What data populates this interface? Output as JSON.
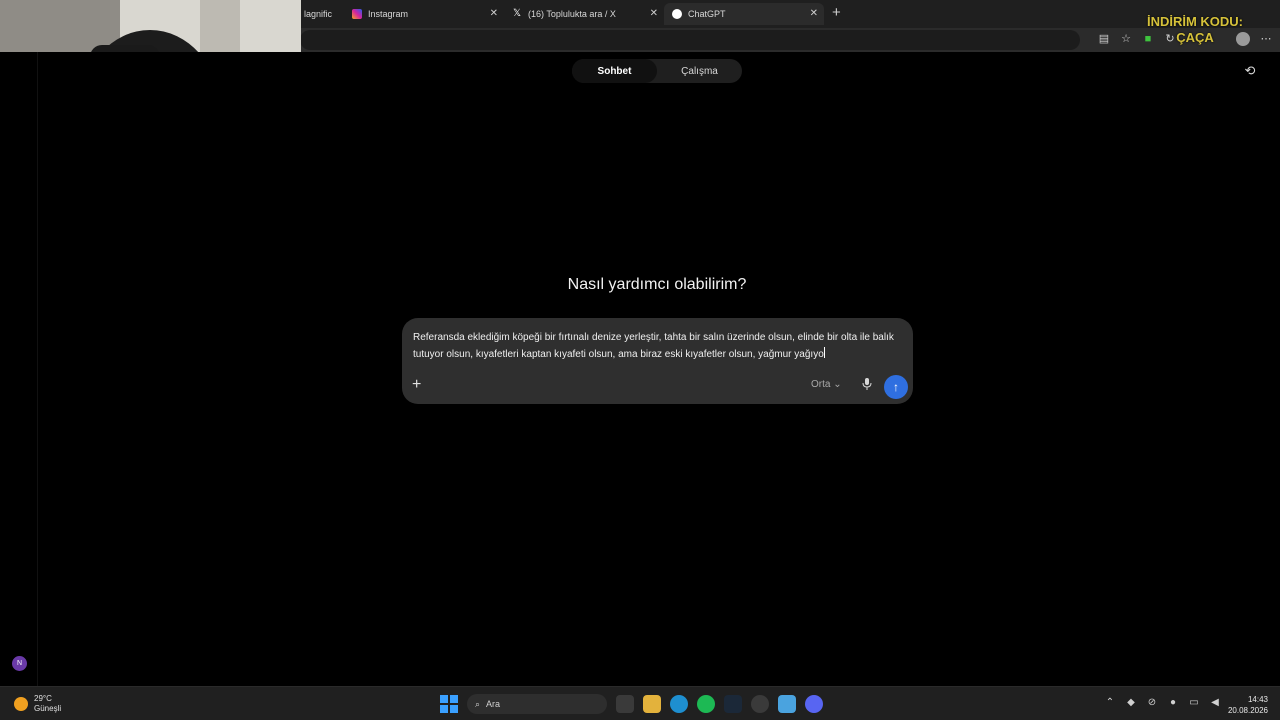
{
  "browser": {
    "tabs": [
      {
        "label": "lagnific",
        "active": false
      },
      {
        "label": "Instagram",
        "active": false
      },
      {
        "label": "(16) Toplulukta ara / X",
        "active": false
      },
      {
        "label": "ChatGPT",
        "active": true
      }
    ],
    "new_tab_glyph": "+",
    "close_glyph": "✕"
  },
  "promo_text": "İNDİRİM KODU: ÇAÇA",
  "app": {
    "modes": [
      {
        "label": "Sohbet",
        "active": true
      },
      {
        "label": "Çalışma",
        "active": false
      }
    ],
    "headline": "Nasıl yardımcı olabilirim?",
    "composer": {
      "text": "Referansda eklediğim köpeği bir fırtınalı denize yerleştir, tahta bir salın üzerinde olsun, elinde bir olta ile balık tutuyor olsun, kıyafetleri kaptan kıyafeti olsun, ama biraz eski kıyafetler olsun, yağmur yağıyo",
      "level_label": "Orta",
      "level_chevron": "⌄",
      "plus_glyph": "+",
      "send_glyph": "↑"
    },
    "user_initial": "N"
  },
  "taskbar": {
    "weather": {
      "temp": "29°C",
      "condition": "Güneşli"
    },
    "search_placeholder": "Ara",
    "clock": {
      "time": "14:43",
      "date": "20.08.2026"
    }
  },
  "colors": {
    "accent_send": "#2f6fe0",
    "promo": "#d6c23a"
  }
}
